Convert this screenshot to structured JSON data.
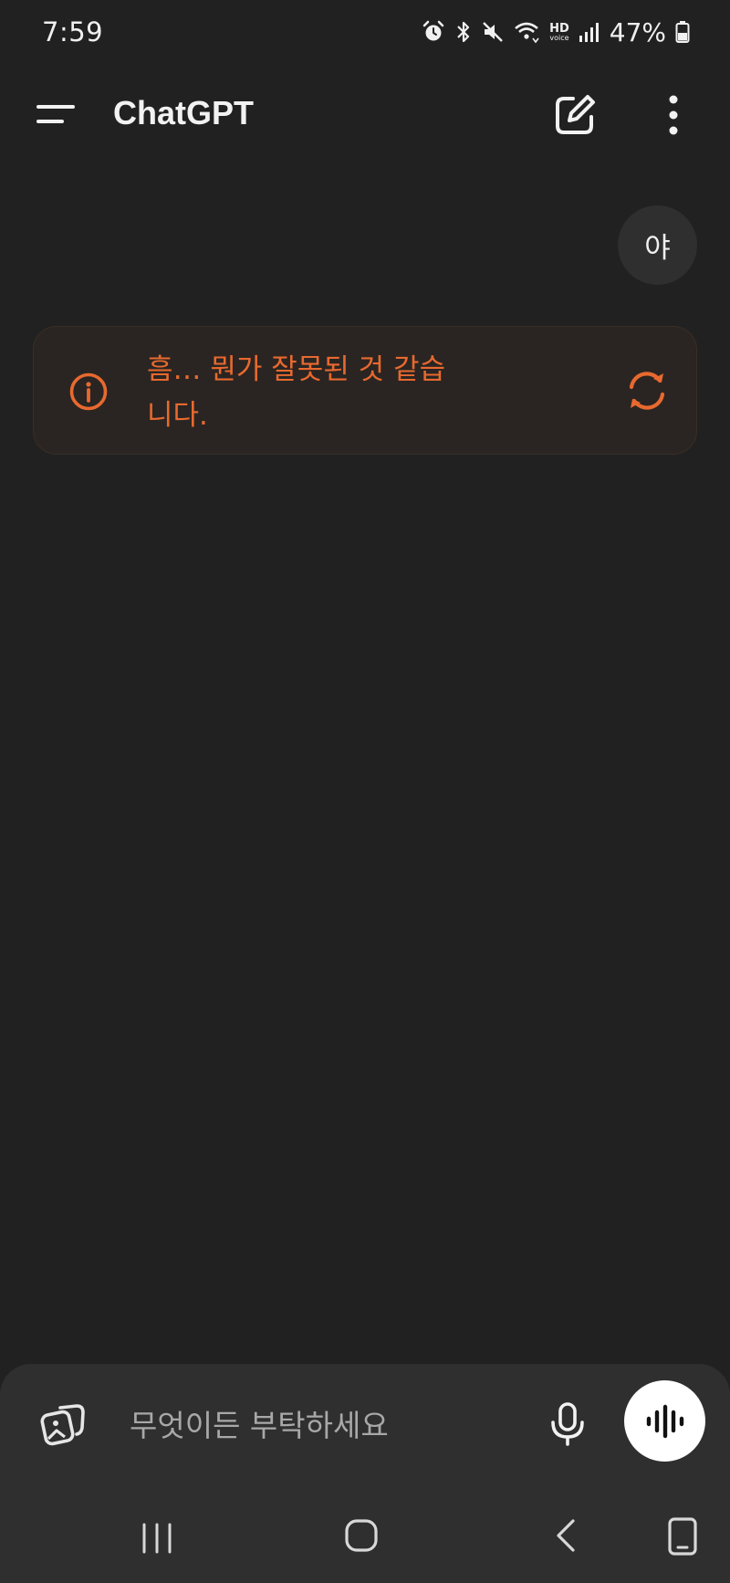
{
  "status_bar": {
    "time": "7:59",
    "battery_percent": "47%",
    "hd_label": "HD",
    "voice_label": "voice",
    "icons": [
      "alarm-icon",
      "bluetooth-icon",
      "mute-icon",
      "wifi-icon",
      "hd-voice-icon",
      "signal-icon",
      "battery-icon"
    ]
  },
  "app_bar": {
    "title": "ChatGPT",
    "icons": [
      "menu-icon",
      "new-chat-icon",
      "more-vertical-icon"
    ]
  },
  "conversation": {
    "user_message": "야",
    "error_message": "흠… 뭔가 잘못된 것 같습니다.",
    "error_icon": "info-icon",
    "retry_icon": "refresh-icon"
  },
  "composer": {
    "placeholder": "무엇이든 부탁하세요",
    "icons": [
      "attach-image-icon",
      "microphone-icon",
      "voice-mode-icon"
    ]
  },
  "nav_bar": {
    "icons": [
      "recents-icon",
      "home-icon",
      "back-icon",
      "rotate-icon"
    ]
  },
  "colors": {
    "background": "#212121",
    "surface": "#2f2f2f",
    "error_accent": "#e8692f",
    "error_card_bg": "#2a2522",
    "text": "#ececec"
  }
}
